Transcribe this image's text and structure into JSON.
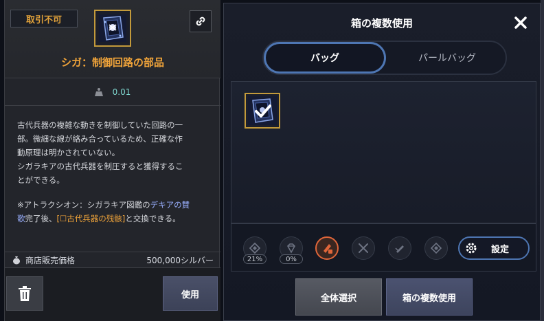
{
  "tooltip": {
    "trade_badge": "取引不可",
    "item_name": "シガ：制御回路の部品",
    "weight": "0.01",
    "description_lines": [
      "古代兵器の複雑な動きを制御していた回路の一",
      "部。微細な線が絡み合っているため、正確な作",
      "動原理は明かされていない。",
      "シガラキアの古代兵器を制圧すると獲得するこ",
      "とができる。"
    ],
    "note_line1_prefix": "※アトラクシオン：シガラキア図鑑の",
    "note_line1_hl": "デキアの賛",
    "note_line2_hl": "歌",
    "note_line2_mid": "完了後、",
    "note_line2_link": "[☐古代兵器の残骸]",
    "note_line2_suffix": "と交換できる。",
    "price_label": "商店販売価格",
    "price_value": "500,000シルバー",
    "use_button": "使用"
  },
  "modal": {
    "title": "箱の複数使用",
    "tabs": [
      {
        "label": "バッグ",
        "active": true
      },
      {
        "label": "パールバッグ",
        "active": false
      }
    ],
    "tool_badges": [
      "21%",
      "0%"
    ],
    "settings_button": "設定",
    "select_all_button": "全体選択",
    "multi_use_button": "箱の複数使用"
  },
  "icons": [
    "trash-icon",
    "link-icon",
    "close-icon",
    "weight-icon",
    "money-bag-icon",
    "gear-icon",
    "checkmark-icon"
  ],
  "colors": {
    "accent_orange": "#f0a43a",
    "accent_blue": "#4e76b3",
    "weight_teal": "#7fd8d0",
    "highlight_blue": "#9ab0ff"
  }
}
